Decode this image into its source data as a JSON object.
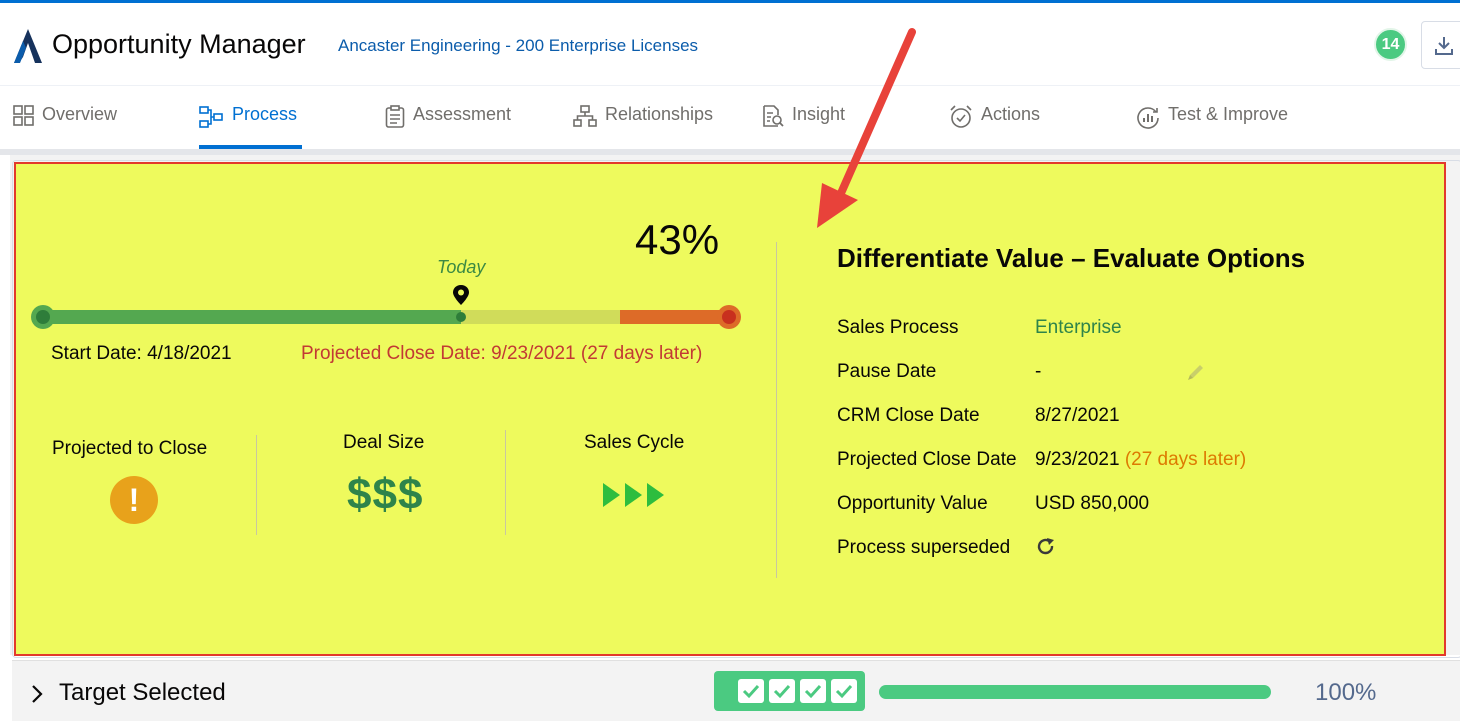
{
  "header": {
    "app_title": "Opportunity Manager",
    "opportunity_link": "Ancaster Engineering - 200 Enterprise Licenses",
    "notification_count": "14",
    "download_icon": "download-icon"
  },
  "tabs": [
    {
      "label": "Overview",
      "icon": "grid-icon"
    },
    {
      "label": "Process",
      "icon": "process-icon",
      "active": true
    },
    {
      "label": "Assessment",
      "icon": "clipboard-icon"
    },
    {
      "label": "Relationships",
      "icon": "hierarchy-icon"
    },
    {
      "label": "Insight",
      "icon": "insight-icon"
    },
    {
      "label": "Actions",
      "icon": "alarm-clock-icon"
    },
    {
      "label": "Test & Improve",
      "icon": "chart-cycle-icon"
    }
  ],
  "timeline": {
    "percent_text": "43%",
    "progress_fraction": 0.43,
    "today_label": "Today",
    "start_date": "Start Date: 4/18/2021",
    "projected_close": "Projected Close Date: 9/23/2021 (27 days later)"
  },
  "metrics": {
    "projected_to_close_label": "Projected to Close",
    "deal_size_label": "Deal Size",
    "deal_size_value": "$$$",
    "sales_cycle_label": "Sales Cycle"
  },
  "details": {
    "title": "Differentiate Value – Evaluate Options",
    "rows": [
      {
        "label": "Sales Process",
        "value": "Enterprise"
      },
      {
        "label": "Pause Date",
        "value": "-"
      },
      {
        "label": "CRM Close Date",
        "value": "8/27/2021"
      },
      {
        "label": "Projected Close Date",
        "value": "9/23/2021",
        "note": "(27 days later)"
      },
      {
        "label": "Opportunity Value",
        "value": "USD 850,000"
      },
      {
        "label": "Process superseded",
        "value": ""
      }
    ]
  },
  "footer": {
    "target_label": "Target Selected",
    "checks_completed": 4,
    "progress_percent_text": "100%",
    "progress_fraction": 1.0
  },
  "colors": {
    "accent": "#0070d2",
    "highlight": "#eefa5d",
    "annotation_red": "#e23a2c",
    "green": "#4bca81",
    "warning": "#e8a21b"
  }
}
